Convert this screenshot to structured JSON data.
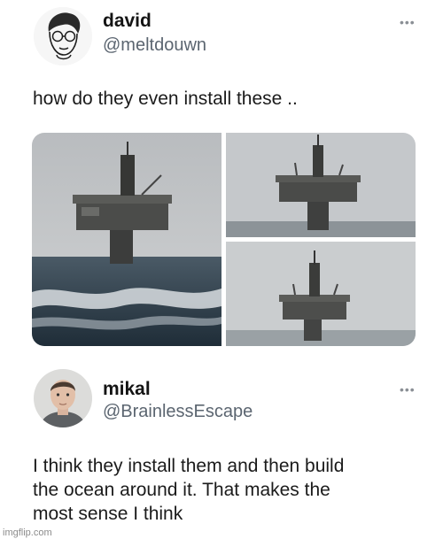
{
  "post1": {
    "author_name": "david",
    "author_handle": "@meltdouwn",
    "text": "how do they even install these ..",
    "more_icon": "more-horizontal-icon",
    "more_glyph": "•••",
    "images": [
      {
        "subject": "oil-platform-in-rough-sea"
      },
      {
        "subject": "oil-platform-in-fog"
      },
      {
        "subject": "oil-platform-in-fog"
      }
    ]
  },
  "post2": {
    "author_name": "mikal",
    "author_handle": "@BrainlessEscape",
    "text_lines": [
      "I think they install them and then build",
      "the ocean around it. That makes the",
      "most sense I think"
    ],
    "more_icon": "more-horizontal-icon",
    "more_glyph": "•••"
  },
  "watermark": "imgflip.com",
  "colors": {
    "handle": "#5b6570",
    "sky": "#c4c7ca",
    "sea": "#3a4a58"
  }
}
